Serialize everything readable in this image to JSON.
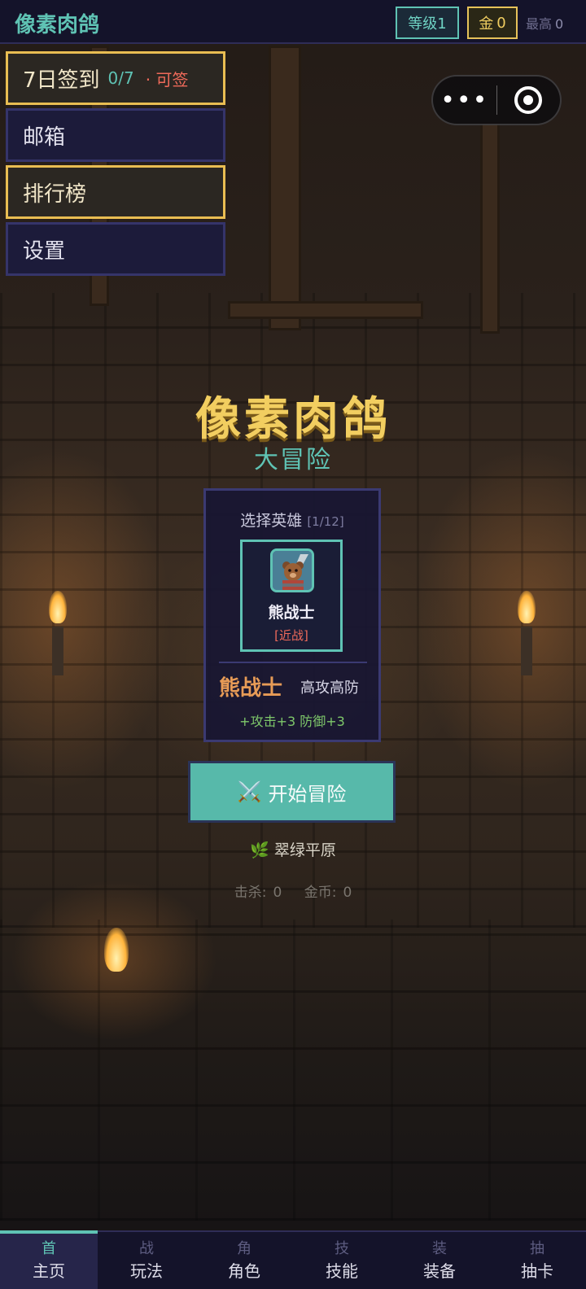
{
  "header": {
    "app_title": "像素肉鸽",
    "level": "等级1",
    "gold_label": "金",
    "gold_value": "0",
    "best_label": "最高",
    "best_value": "0"
  },
  "menu": {
    "checkin_label": "7日签到",
    "checkin_count": "0/7",
    "checkin_status": "· 可签",
    "mailbox": "邮箱",
    "leaderboard": "排行榜",
    "settings": "设置"
  },
  "capsule": {
    "more_icon": "•••",
    "close_icon": "target-circle"
  },
  "title": {
    "main": "像素肉鸽",
    "sub": "大冒险"
  },
  "hero_select": {
    "header": "选择英雄",
    "count": "[1/12]",
    "card_name": "熊战士",
    "card_type": "[近战]",
    "hero_name": "熊战士",
    "hero_desc": "高攻高防",
    "hero_stats": "+攻击+3 防御+3"
  },
  "start_button": {
    "label": "开始冒险",
    "icon": "⚔️"
  },
  "region": {
    "icon": "🌿",
    "name": "翠绿平原"
  },
  "run_stats": {
    "kills_label": "击杀:",
    "kills": "0",
    "coins_label": "金币:",
    "coins": "0"
  },
  "bottom_nav": [
    {
      "glyph": "首",
      "label": "主页"
    },
    {
      "glyph": "战",
      "label": "玩法"
    },
    {
      "glyph": "角",
      "label": "角色"
    },
    {
      "glyph": "技",
      "label": "技能"
    },
    {
      "glyph": "装",
      "label": "装备"
    },
    {
      "glyph": "抽",
      "label": "抽卡"
    }
  ],
  "colors": {
    "accent_teal": "#5fc3b4",
    "accent_gold": "#f2ce60",
    "warning_red": "#ef6a5a",
    "panel_bg": "#1c1b3a"
  }
}
